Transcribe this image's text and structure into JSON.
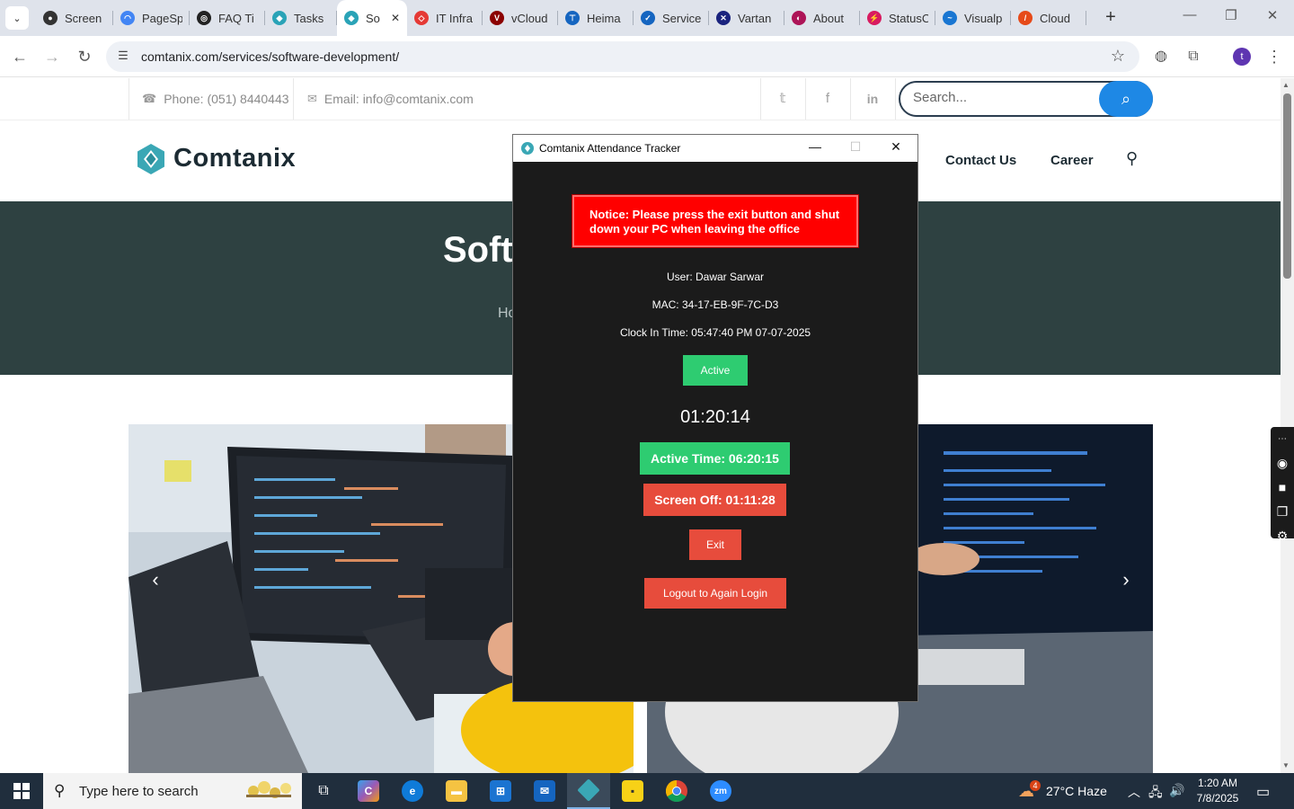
{
  "browser": {
    "tabs": [
      {
        "title": "Screen",
        "favicon_color": "#333333",
        "glyph": "●"
      },
      {
        "title": "PageSp",
        "favicon_color": "#4285f4",
        "glyph": "◠"
      },
      {
        "title": "FAQ Ti",
        "favicon_color": "#222222",
        "glyph": "◎"
      },
      {
        "title": "Tasks",
        "favicon_color": "#2aa3b7",
        "glyph": "◆"
      },
      {
        "title": "So",
        "favicon_color": "#2aa3b7",
        "glyph": "◆",
        "active": true
      },
      {
        "title": "IT Infra",
        "favicon_color": "#e53935",
        "glyph": "◇"
      },
      {
        "title": "vCloud",
        "favicon_color": "#8b0000",
        "glyph": "V"
      },
      {
        "title": "Heima",
        "favicon_color": "#1565c0",
        "glyph": "⊤"
      },
      {
        "title": "Service",
        "favicon_color": "#1565c0",
        "glyph": "✓"
      },
      {
        "title": "Vartan",
        "favicon_color": "#1a237e",
        "glyph": "✕"
      },
      {
        "title": "About",
        "favicon_color": "#ad1457",
        "glyph": "◐"
      },
      {
        "title": "StatusC",
        "favicon_color": "#d81b60",
        "glyph": "⚡"
      },
      {
        "title": "Visualp",
        "favicon_color": "#1976d2",
        "glyph": "~"
      },
      {
        "title": "Cloud",
        "favicon_color": "#e64a19",
        "glyph": "/"
      }
    ],
    "url": "comtanix.com/services/software-development/",
    "profile_initial": "t"
  },
  "site": {
    "phone": "Phone: (051) 8440443",
    "email": "Email: info@comtanix.com",
    "search_placeholder": "Search...",
    "logo_text": "Comtanix",
    "nav": [
      "Contact Us",
      "Career"
    ],
    "hero_title": "Soft",
    "breadcrumb": "Ho",
    "brand_color": "#2e4141",
    "accent_color": "#1e88e5"
  },
  "tracker": {
    "window_title": "Comtanix Attendance Tracker",
    "notice": "Notice: Please press the exit button and shut down your PC when leaving the office",
    "user": "User: Dawar Sarwar",
    "mac": "MAC: 34-17-EB-9F-7C-D3",
    "clock_in": "Clock In Time: 05:47:40 PM 07-07-2025",
    "status": "Active",
    "timer": "01:20:14",
    "active_time": "Active Time: 06:20:15",
    "screen_off": "Screen Off: 01:11:28",
    "exit_label": "Exit",
    "logout_label": "Logout to Again Login"
  },
  "taskbar": {
    "search_placeholder": "Type here to search",
    "weather": "27°C  Haze",
    "weather_badge": "4",
    "time": "1:20 AM",
    "date": "7/8/2025"
  }
}
